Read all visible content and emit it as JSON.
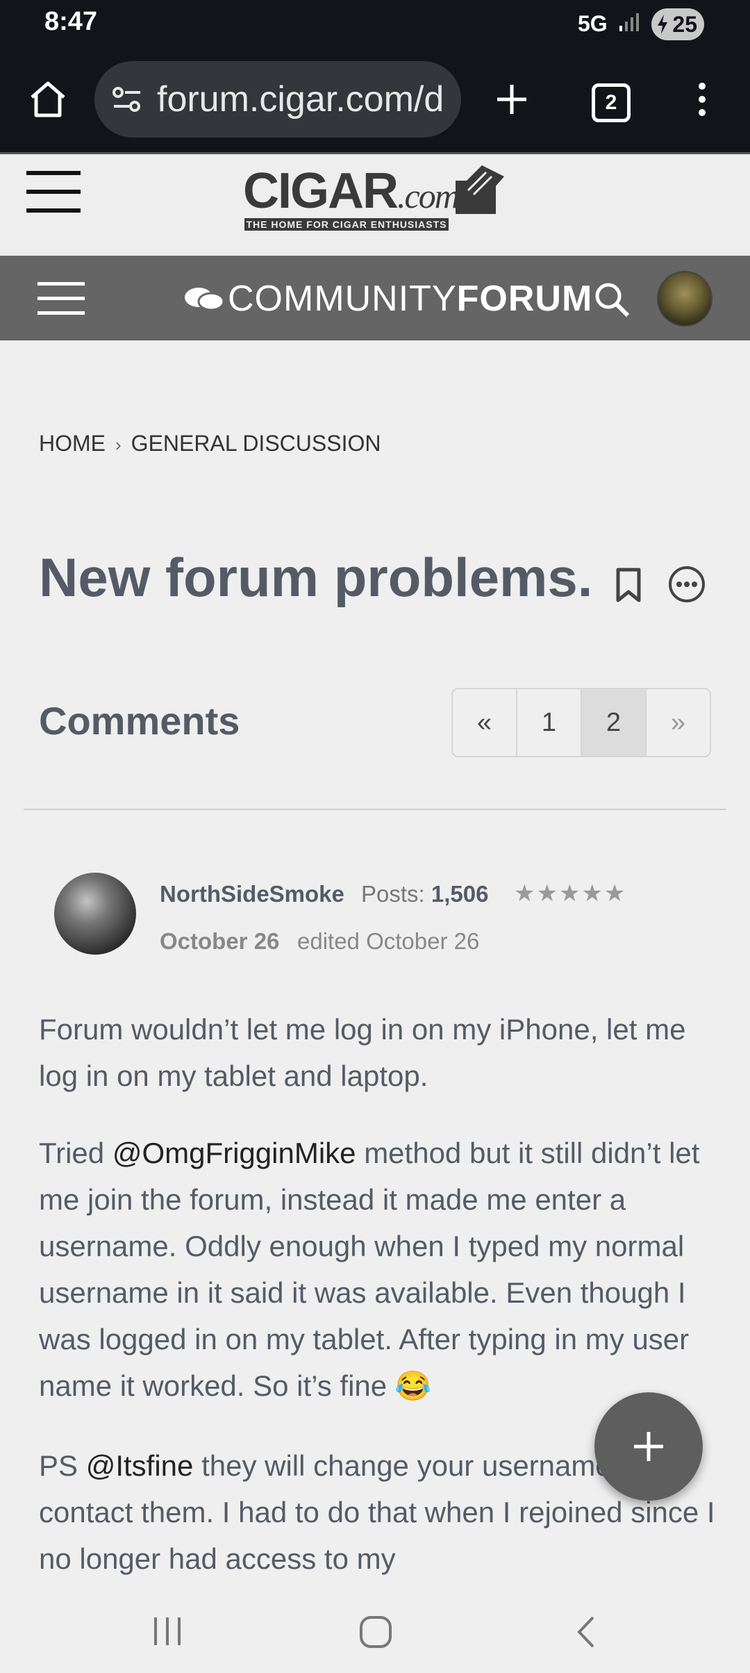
{
  "status_bar": {
    "time": "8:47",
    "network": "5G",
    "battery": "25"
  },
  "browser": {
    "url": "forum.cigar.com/d",
    "tab_count": "2"
  },
  "site": {
    "logo_main": "CIGAR",
    "logo_com": ".com",
    "logo_tagline": "THE HOME FOR CIGAR ENTHUSIASTS"
  },
  "forum_bar": {
    "title_light": "COMMUNITY",
    "title_bold": "FORUM"
  },
  "breadcrumb": {
    "home": "HOME",
    "separator": "›",
    "section": "GENERAL DISCUSSION"
  },
  "thread": {
    "title": "New forum problems."
  },
  "comments": {
    "heading": "Comments",
    "pager": [
      "«",
      "1",
      "2",
      "»"
    ],
    "active_page": "2"
  },
  "post": {
    "author": "NorthSideSmoke",
    "posts_label": "Posts:",
    "posts_count": "1,506",
    "stars": "★★★★★",
    "date": "October 26",
    "edited": "edited October 26",
    "p1": "Forum wouldn’t let me log in on my iPhone, let me log in on my tablet and laptop.",
    "p2_pre": "Tried ",
    "p2_mention": "@OmgFrigginMike",
    "p2_post": " method but it still didn’t let me join the forum, instead it made me enter a username. Oddly enough when I typed my normal username in it said it was available. Even though I was logged in on my tablet. After typing in my user name it worked. So it’s fine 😂",
    "p3_pre": "PS ",
    "p3_mention": "@Itsfine",
    "p3_post": " they will change your username if you contact them. I had to do that when I rejoined since I no longer had access to my"
  },
  "colors": {
    "forum_bar": "#656565",
    "browser_bg": "#13141a",
    "text": "#555b66"
  }
}
